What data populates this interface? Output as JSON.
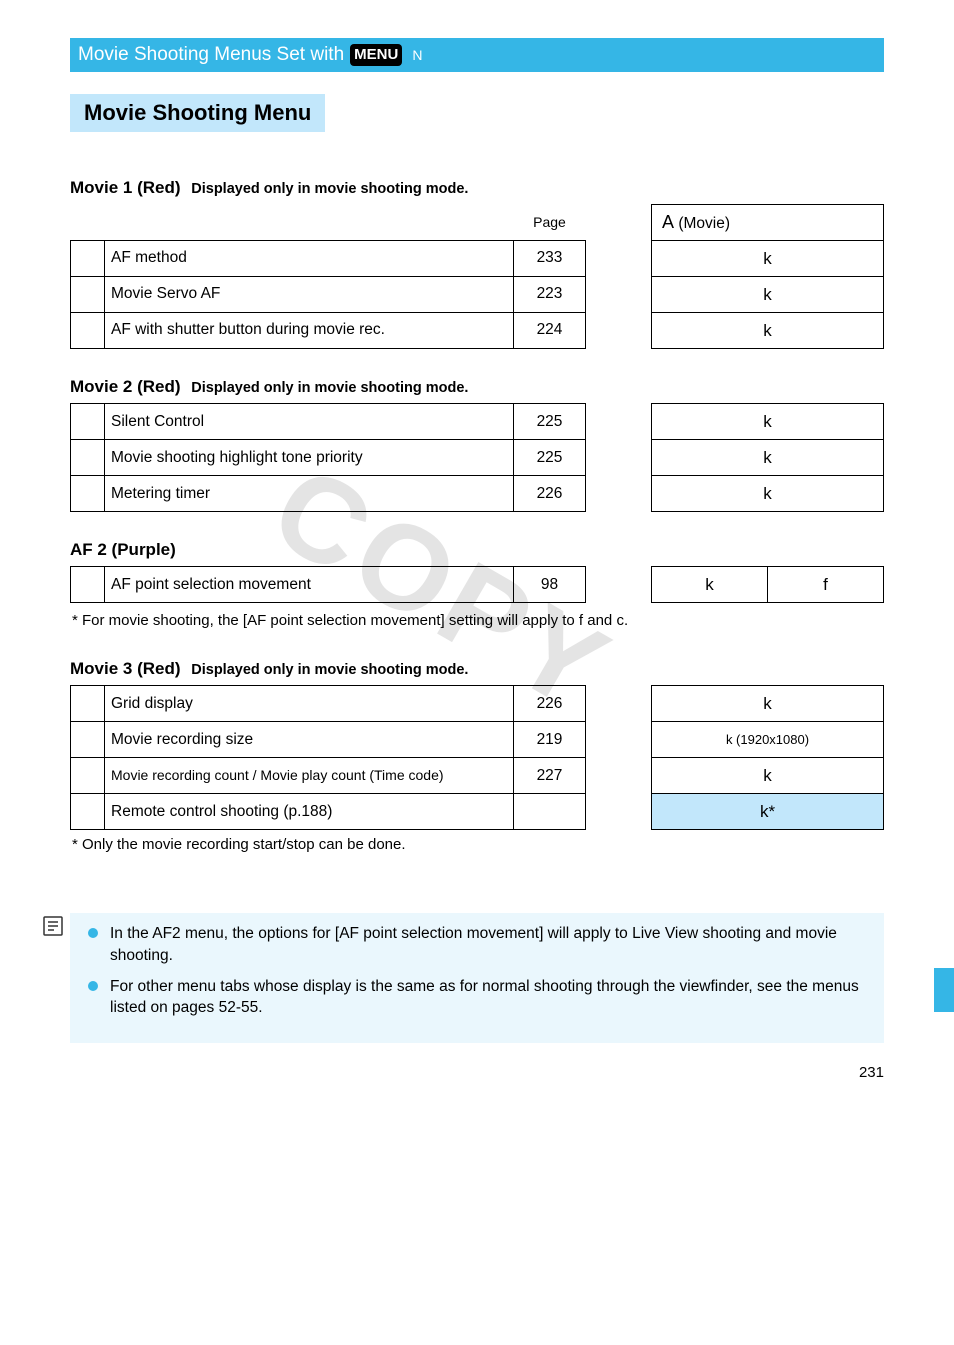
{
  "top": {
    "star": "☆",
    "heading_pre": "Movie Shooting Menus Set with ",
    "heading_badge": "MENU",
    "heading_trailing_star": "N",
    "subheading": "Movie Shooting Menu"
  },
  "categories": [
    {
      "label": "Movie 1 (Red)",
      "note": "Displayed only in movie shooting mode.",
      "header_left": [
        "",
        "",
        "Page"
      ],
      "header_right_icon": "A",
      "header_right_fill": "(Movie)",
      "rows": [
        {
          "label": "AF method",
          "page": "233",
          "a": "k",
          "b": ""
        },
        {
          "label": "Movie Servo AF",
          "page": "223",
          "a": "k",
          "b": ""
        },
        {
          "label": "AF with shutter button during movie rec.",
          "page": "224",
          "a": "k",
          "b": ""
        }
      ]
    },
    {
      "label": "Movie 2 (Red)",
      "note": "Displayed only in movie shooting mode.",
      "rows": [
        {
          "label": "Silent Control",
          "page": "225",
          "a": "k",
          "b": ""
        },
        {
          "label": "Movie shooting highlight tone priority",
          "page": "225",
          "a": "k",
          "b": ""
        },
        {
          "label": "Metering timer",
          "page": "226",
          "a": "k",
          "b": ""
        }
      ]
    },
    {
      "label": "AF 2 (Purple)",
      "note": "",
      "rows": [
        {
          "label": "AF point selection movement",
          "page": "98",
          "a": "k",
          "b": "f"
        }
      ],
      "note_row": "* For movie shooting, the [AF point selection movement] setting will apply to f and c."
    },
    {
      "label": "Movie 3 (Red)",
      "note": "Displayed only in movie shooting mode.",
      "rows": [
        {
          "label": "Grid display",
          "page": "226",
          "a": "k",
          "b": ""
        },
        {
          "label": "Movie recording size",
          "page": "219",
          "a": "k (1920x1080)",
          "b": ""
        },
        {
          "label": "Movie recording count / Movie play count (Time code)",
          "page": "227",
          "a": "k",
          "b": ""
        },
        {
          "label_html": true,
          "label": "Remote control shooting (p.188)",
          "page": "",
          "a_hl": true,
          "a": "k*",
          "b": ""
        }
      ],
      "subnote": "* Only the movie recording start/stop can be done."
    }
  ],
  "notes": {
    "items": [
      "In the AF2 menu, the options for [AF point selection movement] will apply to Live View shooting and movie shooting.",
      "For other menu tabs whose display is the same as for normal shooting through the viewfinder, see the menus listed on pages 52-55."
    ]
  },
  "pageNumber": "231"
}
